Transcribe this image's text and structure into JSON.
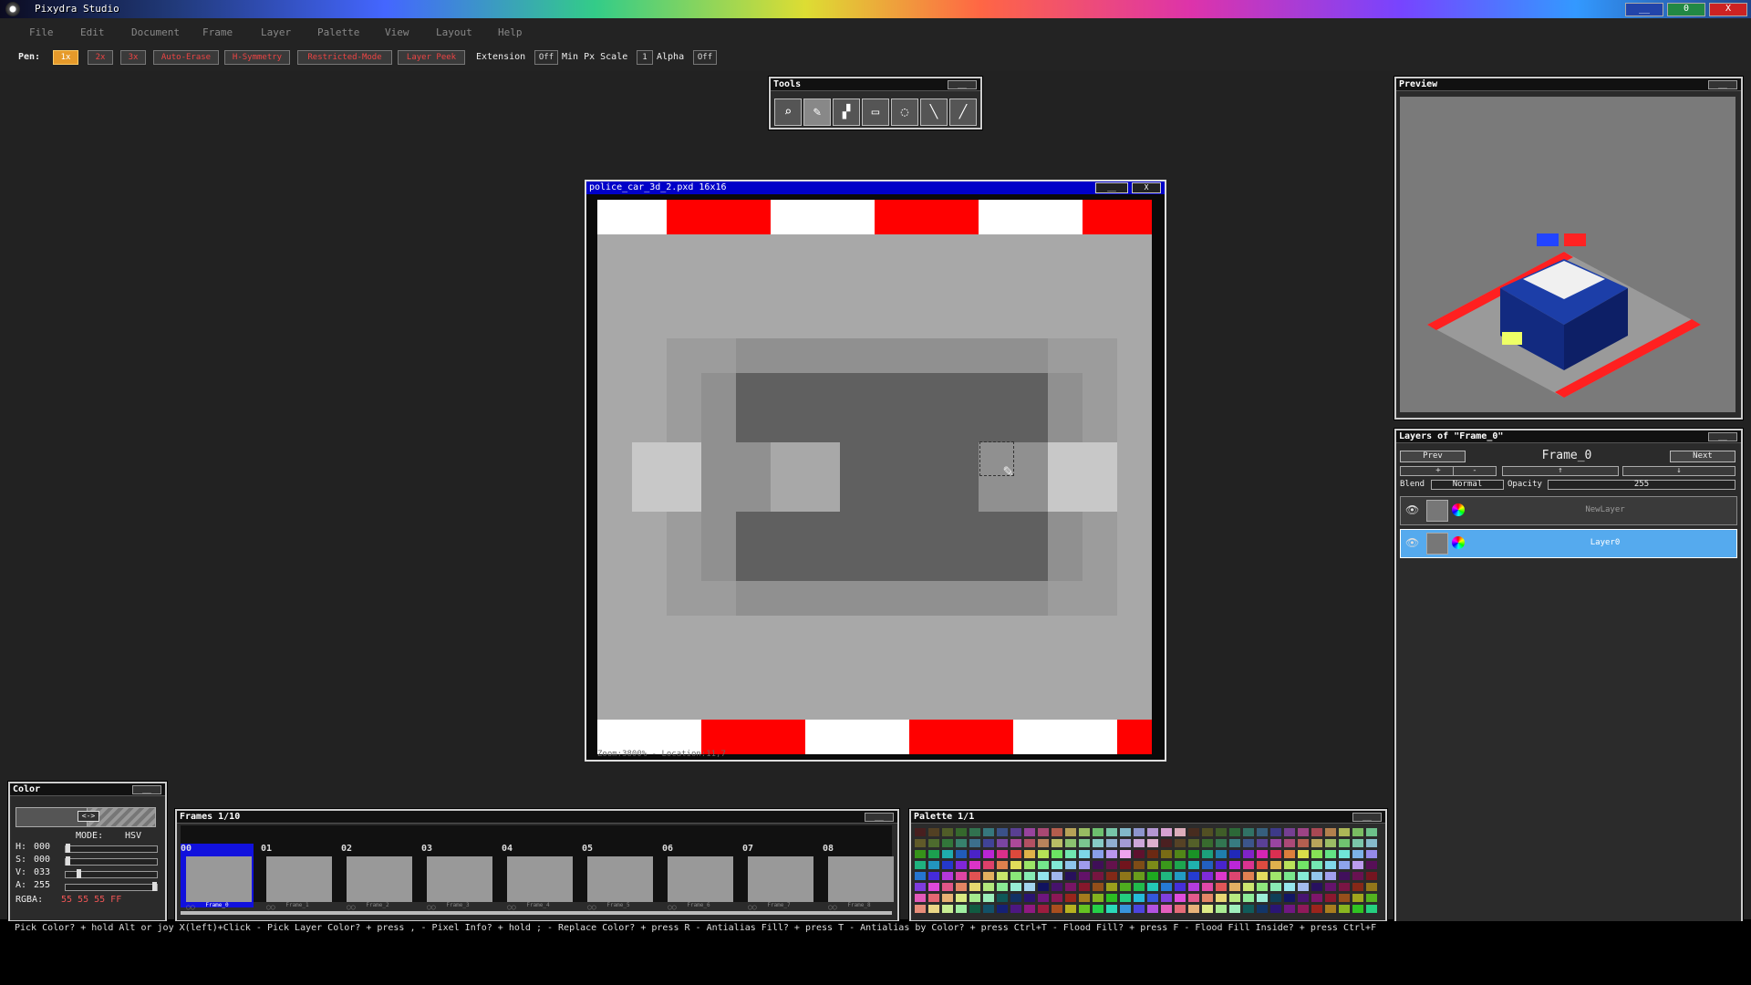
{
  "window": {
    "title": "Pixydra Studio",
    "buttons": {
      "minimize": "__",
      "restore": "0",
      "close": "X"
    }
  },
  "menu": [
    "File",
    "Edit",
    "Document",
    "Frame",
    "Layer",
    "Palette",
    "View",
    "Layout",
    "Help"
  ],
  "toolbar": {
    "pen_label": "Pen:",
    "sizes": [
      "1x",
      "2x",
      "3x"
    ],
    "options": [
      "Auto-Erase",
      "H-Symmetry",
      "Restricted-Mode",
      "Layer Peek"
    ],
    "extension_label": "Extension",
    "extension_value": "Off",
    "min_px_scale_label": "Min Px Scale",
    "min_px_scale_value": "1",
    "alpha_label": "Alpha",
    "alpha_value": "Off"
  },
  "tools_panel": {
    "title": "Tools",
    "min": "__",
    "tools": [
      {
        "name": "zoom-tool",
        "glyph": "⌕"
      },
      {
        "name": "pen-tool",
        "glyph": "✎"
      },
      {
        "name": "fill-tool",
        "glyph": "▞"
      },
      {
        "name": "select-tool",
        "glyph": "▭"
      },
      {
        "name": "lasso-tool",
        "glyph": "◌"
      },
      {
        "name": "line-tool",
        "glyph": "╲"
      },
      {
        "name": "picker-tool",
        "glyph": "╱"
      }
    ]
  },
  "document": {
    "title": "police_car_3d_2.pxd 16x16",
    "min": "__",
    "close": "X",
    "status": "Zoom:3800% - Location:11,7",
    "pixels": [
      "WWRRRWWWRRRWWWRR",
      "1111111111111111",
      "1111111111111111",
      "1111111111111111",
      "1122333333333221",
      "1123444444444321",
      "1123444444444321",
      "1553311444433551",
      "1553311444433551",
      "1123444444444321",
      "1123444444444321",
      "1122333333333221",
      "1111111111111111",
      "1111111111111111",
      "1111111111111111",
      "WWWRRRWWWRRRWWWR"
    ],
    "pixel_colors": {
      "W": "#ffffff",
      "R": "#ff0000",
      "1": "#a8a8a8",
      "2": "#9c9c9c",
      "3": "#909090",
      "4": "#606060",
      "5": "#c8c8c8"
    }
  },
  "preview": {
    "title": "Preview",
    "min": "__"
  },
  "layers_panel": {
    "title": "Layers of \"Frame_0\"",
    "min": "__",
    "prev": "Prev",
    "next": "Next",
    "frame_name": "Frame_0",
    "ops": [
      "+",
      "-",
      "↑",
      "↓"
    ],
    "blend_label": "Blend",
    "blend_value": "Normal",
    "opacity_label": "Opacity",
    "opacity_value": "255",
    "layers": [
      {
        "name": "NewLayer",
        "selected": false
      },
      {
        "name": "Layer0",
        "selected": true
      }
    ]
  },
  "color_panel": {
    "title": "Color",
    "min": "__",
    "swap": "<->",
    "mode_label": "MODE:",
    "mode_value": "HSV",
    "h_label": "H:",
    "h_value": "000",
    "h": 0,
    "s_label": "S:",
    "s_value": "000",
    "s": 0,
    "v_label": "V:",
    "v_value": "033",
    "v": 0.13,
    "a_label": "A:",
    "a_value": "255",
    "a": 1,
    "rgba_label": "RGBA:",
    "rgba_value": "55 55 55 FF"
  },
  "frames_panel": {
    "title": "Frames 1/10",
    "min": "__",
    "frames": [
      {
        "num": "00",
        "name": "Frame_0"
      },
      {
        "num": "01",
        "name": "Frame_1"
      },
      {
        "num": "02",
        "name": "Frame_2"
      },
      {
        "num": "03",
        "name": "Frame_3"
      },
      {
        "num": "04",
        "name": "Frame_4"
      },
      {
        "num": "05",
        "name": "Frame_5"
      },
      {
        "num": "06",
        "name": "Frame_6"
      },
      {
        "num": "07",
        "name": "Frame_7"
      },
      {
        "num": "08",
        "name": "Frame_8"
      }
    ]
  },
  "palette_panel": {
    "title": "Palette 1/1",
    "min": "__"
  },
  "statusbar": "Pick Color? + hold Alt or joy X(left)+Click  -  Pick Layer Color? + press ,  -  Pixel Info? + hold ;  -  Replace Color? + press R  -  Antialias Fill? + press T  -  Antialias by Color? + press Ctrl+T  -  Flood Fill? + press F  -  Flood Fill Inside? + press Ctrl+F"
}
